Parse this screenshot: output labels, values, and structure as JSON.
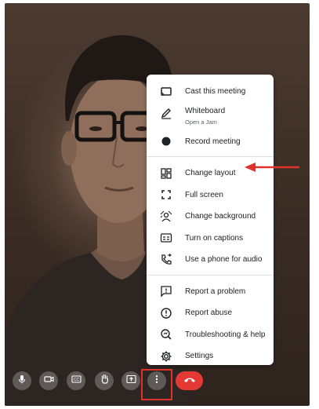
{
  "menu": {
    "items": [
      {
        "label": "Cast this meeting",
        "icon": "cast-icon"
      },
      {
        "label": "Whiteboard",
        "sublabel": "Open a Jam",
        "icon": "pen-icon"
      },
      {
        "label": "Record meeting",
        "icon": "record-icon"
      },
      {
        "label": "Change layout",
        "icon": "layout-icon"
      },
      {
        "label": "Full screen",
        "icon": "fullscreen-icon"
      },
      {
        "label": "Change background",
        "icon": "background-icon"
      },
      {
        "label": "Turn on captions",
        "icon": "captions-icon"
      },
      {
        "label": "Use a phone for audio",
        "icon": "phone-audio-icon"
      },
      {
        "label": "Report a problem",
        "icon": "report-problem-icon"
      },
      {
        "label": "Report abuse",
        "icon": "report-abuse-icon"
      },
      {
        "label": "Troubleshooting & help",
        "icon": "troubleshoot-icon"
      },
      {
        "label": "Settings",
        "icon": "settings-icon"
      }
    ]
  },
  "toolbar": {
    "buttons": [
      "microphone-icon",
      "camera-icon",
      "captions-icon",
      "raise-hand-icon",
      "present-icon",
      "more-options-icon",
      "hang-up-icon"
    ]
  },
  "colors": {
    "annotation": "#e0312b",
    "hangup": "#e53935",
    "toolbar_button": "#5f5a57"
  }
}
